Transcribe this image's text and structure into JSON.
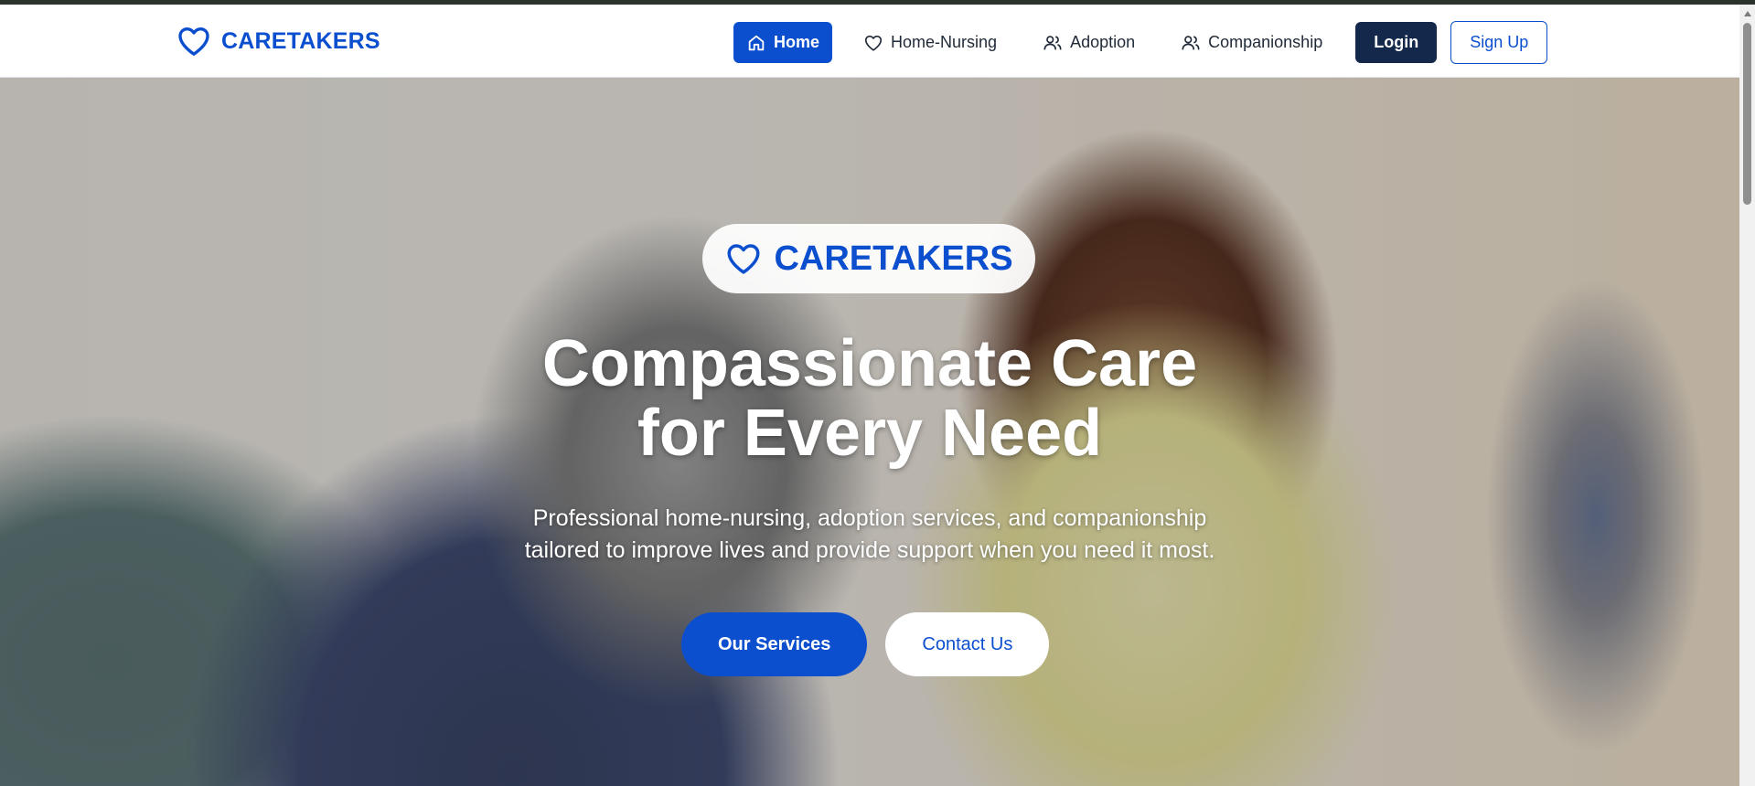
{
  "brand": {
    "name": "CARETAKERS",
    "icon": "heart-icon",
    "color": "#0b4fcf"
  },
  "nav": {
    "items": [
      {
        "label": "Home",
        "icon": "home-icon",
        "active": true
      },
      {
        "label": "Home-Nursing",
        "icon": "heart-icon",
        "active": false
      },
      {
        "label": "Adoption",
        "icon": "users-icon",
        "active": false
      },
      {
        "label": "Companionship",
        "icon": "users-icon",
        "active": false
      }
    ],
    "login_label": "Login",
    "signup_label": "Sign Up"
  },
  "hero": {
    "badge_text": "CARETAKERS",
    "title_line1": "Compassionate Care",
    "title_line2": "for Every Need",
    "subtitle_line1": "Professional home-nursing, adoption services, and companionship",
    "subtitle_line2": "tailored to improve lives and provide support when you need it most.",
    "primary_button": "Our Services",
    "secondary_button": "Contact Us"
  },
  "colors": {
    "accent": "#0b4fcf",
    "dark_button": "#14284b",
    "white": "#ffffff"
  }
}
